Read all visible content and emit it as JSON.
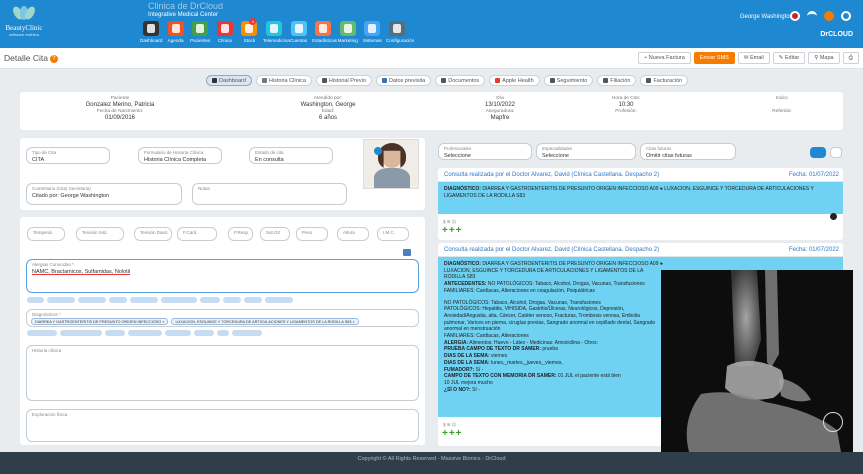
{
  "brand": {
    "name": "BeautyClinic",
    "tagline": "software estética"
  },
  "clinic": {
    "name": "Clinica de DrCloud",
    "center": "Integrative Medical Center"
  },
  "nav": [
    {
      "label": "Dashboard",
      "icon": "dashboard-icon",
      "color": "#333333"
    },
    {
      "label": "Agenda",
      "icon": "phone-icon",
      "color": "#f4511e"
    },
    {
      "label": "Pacientes",
      "icon": "patients-icon",
      "color": "#43a047"
    },
    {
      "label": "Clínica",
      "icon": "clinic-icon",
      "color": "#e53935"
    },
    {
      "label": "Stock",
      "icon": "stock-icon",
      "color": "#fb8c00",
      "badge": "4"
    },
    {
      "label": "Telemedicina",
      "icon": "chat-icon",
      "color": "#26c6da"
    },
    {
      "label": "Cuentas",
      "icon": "accounts-icon",
      "color": "#4fc3f7"
    },
    {
      "label": "Estadísticas",
      "icon": "stats-icon",
      "color": "#ff7043"
    },
    {
      "label": "Marketing",
      "icon": "marketing-icon",
      "color": "#66bb6a"
    },
    {
      "label": "Sistemas",
      "icon": "systems-icon",
      "color": "#42a5f5"
    },
    {
      "label": "Configuración",
      "icon": "config-icon",
      "color": "#546e7a"
    }
  ],
  "user": {
    "name": "George Washington"
  },
  "drcloud": "DrCLOUD",
  "page": {
    "title": "Detalle Cita"
  },
  "actions": {
    "nueva_factura": "Nueva Factura",
    "enviar_sms": "Enviar SMS",
    "email": "Email",
    "editar": "Editar",
    "mapa": "Mapa"
  },
  "tabs": [
    "Dashboard",
    "Historia Clínica",
    "Historial Previo",
    "Datos previsita",
    "Documentos",
    "Apple Health",
    "Seguimiento",
    "Filiación",
    "Facturación"
  ],
  "info": {
    "paciente_label": "Paciente",
    "paciente": "Gonzalez Merino, Patricia",
    "nacimiento_label": "Fecha de Nacimiento:",
    "nacimiento": "01/09/2016",
    "atendido_label": "Atendido por:",
    "atendido": "Washington, George",
    "edad_label": "Edad:",
    "edad": "6 años",
    "dia_label": "Día",
    "dia": "13/10/2022",
    "aseguradora_label": "Aseguradora:",
    "aseguradora": "Mapfre",
    "hora_label": "Hora de Cita:",
    "hora": "10:30",
    "profesion_label": "Profesión:",
    "inicio_label": "Inicio:",
    "referido_label": "Referido:"
  },
  "form": {
    "tipo_label": "Tipo de Cita",
    "tipo": "CITA",
    "formulario_label": "Formulario de Historia Clínica",
    "formulario": "Historia Clínica Completa",
    "estado_label": "Estado de cita",
    "estado": "En consulta",
    "comentario_label": "Comentario (Cita) Secretaria)",
    "comentario": "Citado por: George Washington",
    "notas_label": "Notas",
    "vitals": [
      "Temperat.",
      "Tensión Sist.",
      "Tensión Diast.",
      "F.Card.",
      "F.Resp.",
      "Sat.O2",
      "Peso",
      "Altura",
      "I.M.C."
    ],
    "alergias_label": "Alergias Conocidas *",
    "alergias": "NAMC, Bractamicos, Sulfamidas, Nolotil",
    "diag_label": "Diagnósticos *",
    "diag_chips": [
      "DIARREA Y GASTROENTERITIS DE PRESUNTO ORIGEN INFECCIOSO ×",
      "LUXACION, ESGUINCE Y TORCEDURA DE ARTICULACIONES Y LIGAMENTOS DE LA RODILLA S83 ×"
    ],
    "historia_label": "Historia clínica",
    "exploracion_label": "Exploración física"
  },
  "filters": {
    "profesionales_label": "Profesionales",
    "profesionales": "Seleccione",
    "especialidades_label": "Especialidades",
    "especialidades": "Seleccione",
    "citas_label": "Citas futuras",
    "citas": "Omitir citas futuras"
  },
  "consults": [
    {
      "header": "Consulta realizada por el Doctor Alvarez, David (Clínica Castellana. Despacho 2)",
      "date": "Fecha: 01/07/2022",
      "diag_label": "DIAGNÓSTICO:",
      "diag": "DIARREA Y GASTROENTERITIS DE PRESUNTO ORIGEN INFECCIOSO A09 ● LUXACION, ESGUINCE Y TORCEDURA DE ARTICULACIONES Y LIGAMENTOS DE LA RODILLA S83"
    },
    {
      "header": "Consulta realizada por el Doctor Alvarez, David (Clínica Castellana. Despacho 2)",
      "date": "Fecha: 01/07/2022",
      "diag_label": "DIAGNÓSTICO:",
      "diag": "DIARREA Y GASTROENTERITIS DE PRESUNTO ORIGEN INFECCIOSO A09 ● LUXACION, ESGUINCE Y TORCEDURA DE ARTICULACIONES Y LIGAMENTOS DE LA RODILLA S83",
      "ant_label": "ANTECEDENTES:",
      "ant": "NO PATOLÓGICOS: Tabaco, Alcohol, Drogas, Vacunas, Transfusiones",
      "fam1": "FAMILIARES: Cardiacas, Alteraciones en coagulación, Psiquiátricas",
      "nopat": "NO PATOLÓGICOS: Tabaco, Alcohol, Drogas, Vacunas, Transfusiones",
      "pat": "PATOLÓGICOS: Hepatitis, VIH/SIDA, Gastritis/Úlceras, Neurológicos, Depresión, Ansiedad/Angustia, alta, Cáncer, Catéter venoso, Fracturas, Trombosis venosa, Embolia pulmonar, Varices en pierna, cirugías previas, Sangrado anormal en cepillado dental, Sangrado anormal en menstruación",
      "fam2": "FAMILIARES: Cardiacas, Alteraciones",
      "alergia_label": "ALERGIA:",
      "alergia": "Alimentos: Huevo - Látex - Medicinas: Amoxicilina - Otros:",
      "prueba_label": "PRUEBA CAMPO DE TEXTO DR SAMER:",
      "prueba": "prueba",
      "dias1_label": "DIAS DE LA SEMA:",
      "dias1": "viernes",
      "dias2_label": "DIAS DE LA SEMA:",
      "dias2": "lunes,_martes,_jueves,_viernes,",
      "fumador_label": "FUMADOR?:",
      "fumador": "Sí -",
      "memoria_label": "CAMPO DE TEXTO CON MEMORIA DR SAMER:",
      "memoria": "01 JUL el paciente está bien",
      "memoria2": "10 JUL mejora mucho",
      "sino_label": "¿SÍ O NO?:",
      "sino": "Sí -"
    }
  ],
  "footer": "Copyright © All Rights Reserved - Massive Bionics - DrCloud",
  "colors": {
    "topbar": "#1e88d0",
    "consult_body": "#6fd2f3",
    "sms": "#f57c00"
  }
}
